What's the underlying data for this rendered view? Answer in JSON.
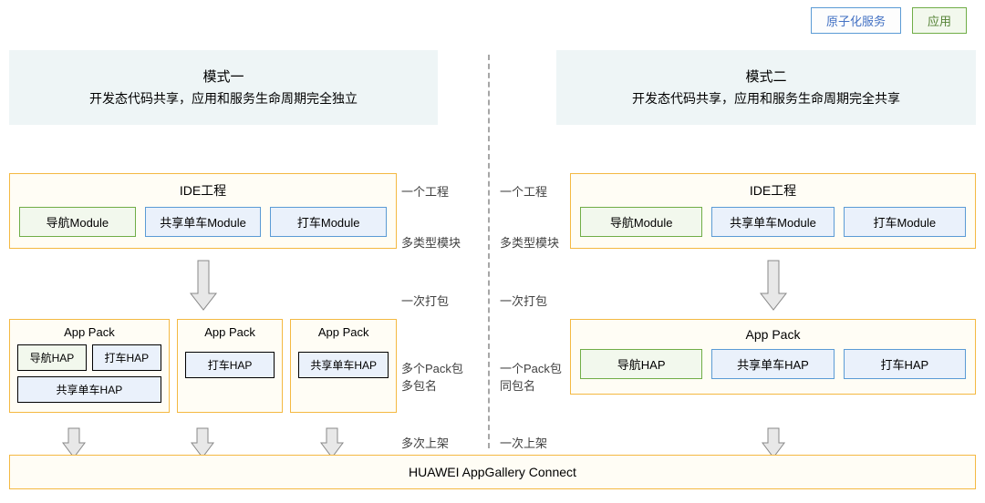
{
  "legend": {
    "atomic": "原子化服务",
    "app": "应用"
  },
  "left": {
    "title": "模式一",
    "subtitle": "开发态代码共享，应用和服务生命周期完全独立",
    "ide": {
      "title": "IDE工程",
      "modules": [
        "导航Module",
        "共享单车Module",
        "打车Module"
      ]
    },
    "packs": [
      {
        "title": "App Pack",
        "haps": [
          {
            "label": "导航HAP",
            "cls": "mod-green"
          },
          {
            "label": "打车HAP",
            "cls": "mod-blue"
          },
          {
            "label": "共享单车HAP",
            "cls": "mod-blue"
          }
        ]
      },
      {
        "title": "App Pack",
        "haps": [
          {
            "label": "打车HAP",
            "cls": "mod-blue"
          }
        ]
      },
      {
        "title": "App Pack",
        "haps": [
          {
            "label": "共享单车HAP",
            "cls": "mod-blue"
          }
        ]
      }
    ]
  },
  "right": {
    "title": "模式二",
    "subtitle": "开发态代码共享，应用和服务生命周期完全共享",
    "ide": {
      "title": "IDE工程",
      "modules": [
        "导航Module",
        "共享单车Module",
        "打车Module"
      ]
    },
    "pack": {
      "title": "App Pack",
      "haps": [
        {
          "label": "导航HAP",
          "cls": "mod-green"
        },
        {
          "label": "共享单车HAP",
          "cls": "mod-blue"
        },
        {
          "label": "打车HAP",
          "cls": "mod-blue"
        }
      ]
    }
  },
  "labels": {
    "row1": "一个工程",
    "row1r": "一个工程",
    "row2": "多类型模块",
    "row2r": "多类型模块",
    "row3": "一次打包",
    "row3r": "一次打包",
    "row4l": "多个Pack包\n多包名",
    "row4r": "一个Pack包\n同包名",
    "row5l": "多次上架",
    "row5r": "一次上架"
  },
  "bottom": "HUAWEI AppGallery Connect"
}
